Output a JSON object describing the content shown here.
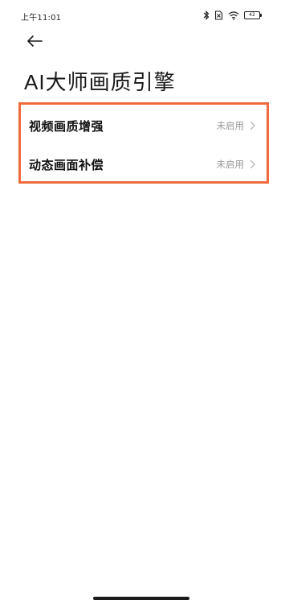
{
  "status_bar": {
    "time": "上午11:01",
    "battery": "42",
    "icons": [
      "bluetooth-icon",
      "no-sim-icon",
      "wifi-icon",
      "battery-icon"
    ]
  },
  "header": {
    "back_icon": "back-arrow-icon",
    "title": "AI大师画质引擎"
  },
  "settings": {
    "items": [
      {
        "label": "视频画质增强",
        "value": "未启用",
        "icon": "chevron-right-icon"
      },
      {
        "label": "动态画面补偿",
        "value": "未启用",
        "icon": "chevron-right-icon"
      }
    ],
    "highlight_color": "#f06a3c"
  },
  "colors": {
    "value_text": "#9a9a9a",
    "title_text": "#1a1a1a"
  }
}
